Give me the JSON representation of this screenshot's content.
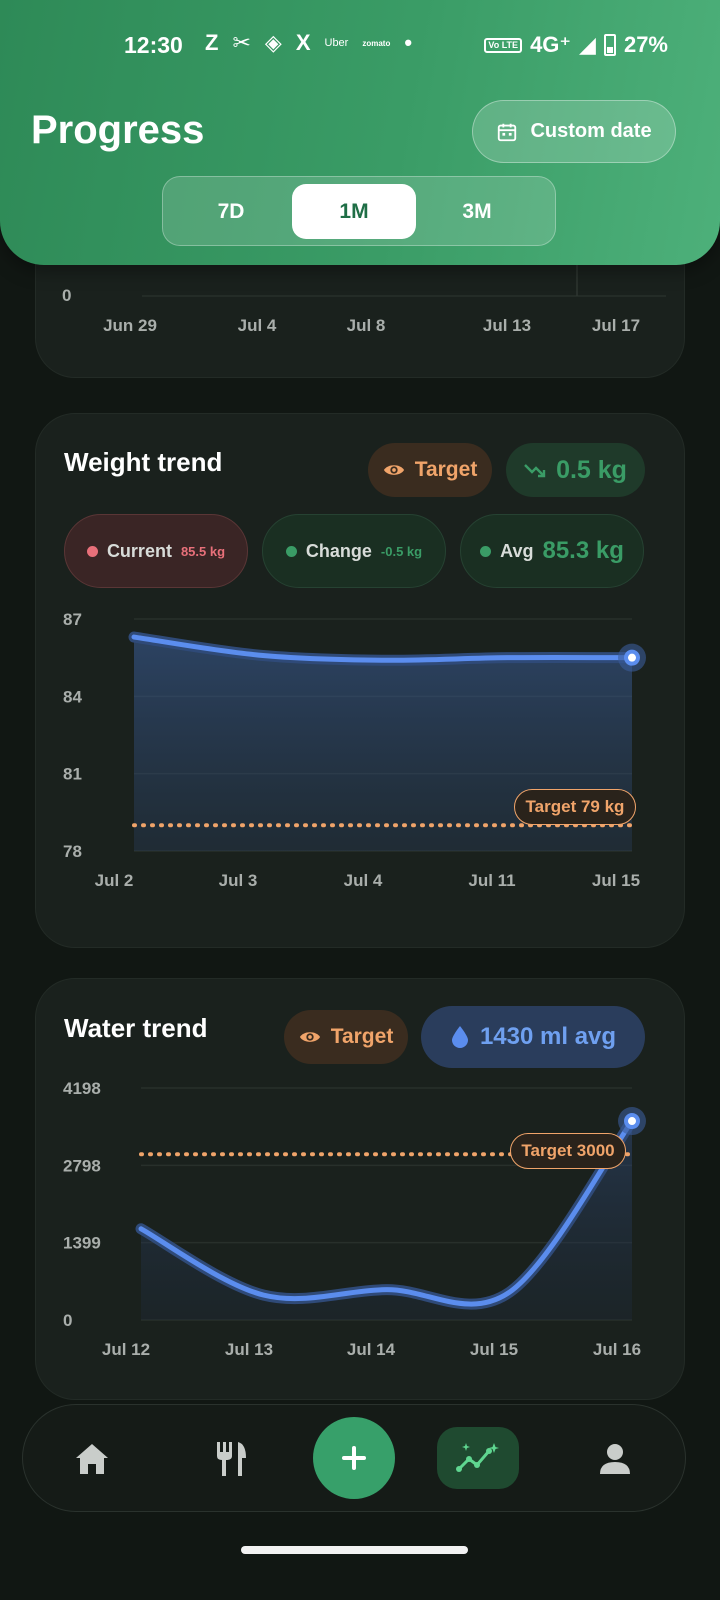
{
  "status": {
    "time": "12:30",
    "icons": [
      "Z",
      "X"
    ],
    "uber": "Uber",
    "zomato": "zomato",
    "volte": "Vo LTE",
    "network": "4G⁺",
    "battery": "27%"
  },
  "header": {
    "title": "Progress",
    "custom_date": "Custom date",
    "ranges": [
      "7D",
      "1M",
      "3M"
    ],
    "selected_range": "1M"
  },
  "top_card": {
    "y_zero": "0",
    "x_ticks": [
      "Jun 29",
      "Jul 4",
      "Jul 8",
      "Jul 13",
      "Jul 17"
    ]
  },
  "weight": {
    "title": "Weight trend",
    "target_button": "Target",
    "change_pill": "0.5 kg",
    "stats": {
      "current_label": "Current",
      "current_value": "85.5 kg",
      "change_label": "Change",
      "change_value": "-0.5 kg",
      "avg_label": "Avg",
      "avg_value": "85.3 kg"
    },
    "target_label": "Target 79 kg",
    "colors": {
      "current": "#e8707a",
      "positive": "#3a9c66",
      "line": "#5b8dee",
      "target": "#f0a46a"
    }
  },
  "water": {
    "title": "Water trend",
    "target_button": "Target",
    "avg_pill": "1430 ml avg",
    "target_label": "Target 3000"
  },
  "chart_data": [
    {
      "type": "line",
      "title": "Weight trend",
      "categories": [
        "Jul 2",
        "Jul 3",
        "Jul 4",
        "Jul 11",
        "Jul 15"
      ],
      "series": [
        {
          "values": [
            86.3,
            85.6,
            85.4,
            85.5,
            85.5
          ]
        }
      ],
      "target": 79,
      "ylim": [
        78,
        87
      ],
      "yticks": [
        "87",
        "84",
        "81",
        "78"
      ]
    },
    {
      "type": "line",
      "title": "Water trend",
      "categories": [
        "Jul 12",
        "Jul 13",
        "Jul 14",
        "Jul 15",
        "Jul 16"
      ],
      "series": [
        {
          "values": [
            1650,
            450,
            550,
            500,
            3600
          ]
        }
      ],
      "target": 3000,
      "ylim": [
        0,
        4198
      ],
      "yticks": [
        "4198",
        "2798",
        "1399",
        "0"
      ]
    }
  ],
  "nav": {
    "items": [
      "home-icon",
      "restaurant-icon",
      "add-icon",
      "trending-icon",
      "person-icon"
    ],
    "active": "trending-icon"
  }
}
